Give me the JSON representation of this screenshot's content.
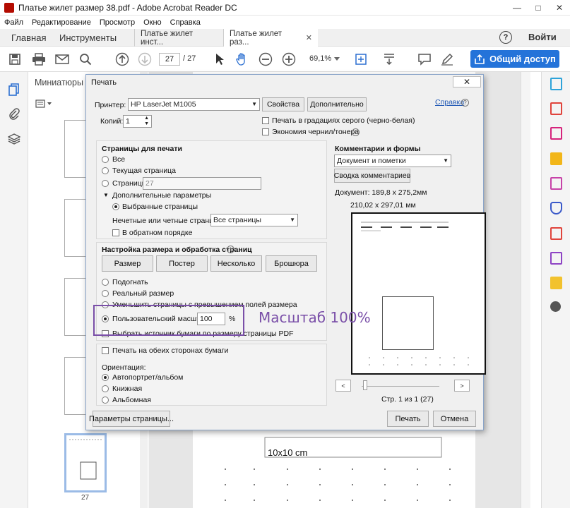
{
  "window": {
    "title": "Платье жилет размер 38.pdf - Adobe Acrobat Reader DC"
  },
  "menu": [
    "Файл",
    "Редактирование",
    "Просмотр",
    "Окно",
    "Справка"
  ],
  "tabs": {
    "home": "Главная",
    "tools": "Инструменты",
    "doc1": "Платье жилет инст...",
    "doc2": "Платье жилет раз...",
    "signin": "Войти"
  },
  "toolbar": {
    "page_current": "27",
    "page_total": "/ 27",
    "zoom": "69,1%",
    "share": "Общий доступ"
  },
  "thumbs": {
    "header": "Миниатюры с",
    "selected_page": "27"
  },
  "dialog": {
    "title": "Печать",
    "printer_label": "Принтер:",
    "printer_value": "HP LaserJet M1005",
    "properties_btn": "Свойства",
    "advanced_btn": "Дополнительно",
    "help_link": "Справка",
    "copies_label": "Копий:",
    "copies_value": "1",
    "grayscale": "Печать в градациях серого (черно-белая)",
    "ink_save": "Экономия чернил/тонера",
    "pages_heading": "Страницы для печати",
    "all": "Все",
    "current": "Текущая страница",
    "pages": "Страницы",
    "pages_value": "27",
    "more_options": "Дополнительные параметры",
    "selected_pages": "Выбранные страницы",
    "odd_even_label": "Нечетные или четные страницы:",
    "odd_even_value": "Все страницы",
    "reverse": "В обратном порядке",
    "size_heading": "Настройка размера и обработка страниц",
    "size_btn": "Размер",
    "poster_btn": "Постер",
    "multiple_btn": "Несколько",
    "booklet_btn": "Брошюра",
    "fit": "Подогнать",
    "actual": "Реальный размер",
    "shrink": "Уменьшить страницы с превышением полей размера",
    "custom_scale": "Пользовательский масштаб:",
    "custom_scale_value": "100",
    "percent": "%",
    "paper_source": "Выбрать источник бумаги по размеру страницы PDF",
    "duplex": "Печать на обеих сторонах бумаги",
    "orientation_label": "Ориентация:",
    "auto": "Автопортрет/альбом",
    "portrait": "Книжная",
    "landscape": "Альбомная",
    "comments_heading": "Комментарии и формы",
    "comments_value": "Документ и пометки",
    "summarize_btn": "Сводка комментариев",
    "doc_size": "Документ: 189,8 x 275,2мм",
    "paper_size": "210,02 x 297,01 мм",
    "page_info": "Стр. 1 из 1 (27)",
    "page_setup_btn": "Параметры страницы...",
    "print_btn": "Печать",
    "cancel_btn": "Отмена"
  },
  "doc": {
    "box_label": "10x10 cm"
  },
  "annotation": "Масштаб 100%"
}
